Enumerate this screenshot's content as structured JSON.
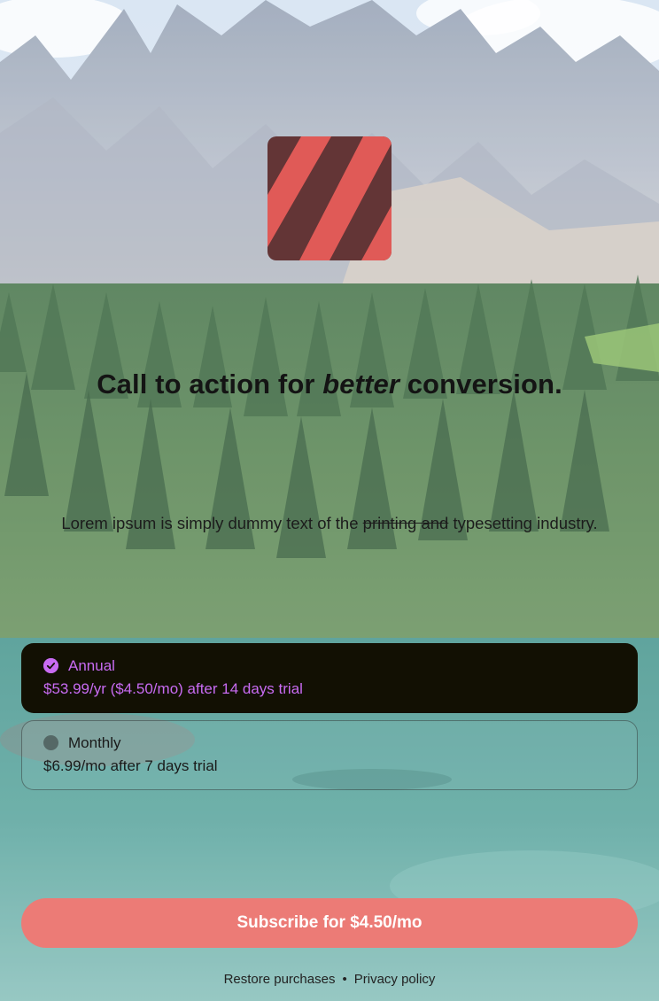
{
  "headline": {
    "before": "Call to action for ",
    "emphasis": "better",
    "after": " conversion."
  },
  "subtext": {
    "before": "Lorem ipsum is simply dummy text of the ",
    "strikethrough": "printing and",
    "after": " typesetting industry."
  },
  "plans": [
    {
      "title": "Annual",
      "price": "$53.99/yr ($4.50/mo) after 14 days trial",
      "selected": true
    },
    {
      "title": "Monthly",
      "price": "$6.99/mo after 7 days trial",
      "selected": false
    }
  ],
  "cta": {
    "label": "Subscribe for $4.50/mo"
  },
  "footer": {
    "restore": "Restore purchases",
    "separator": "•",
    "privacy": "Privacy policy"
  },
  "colors": {
    "accent": "#c86bf2",
    "cta": "#ec7b76",
    "logo_dark": "#633536",
    "logo_light": "#e05a57",
    "selected_plan_bg": "#121003"
  },
  "icons": {
    "logo": "striped-logo-icon",
    "selected_radio": "check-circle-icon",
    "unselected_radio": "empty-radio-icon"
  }
}
